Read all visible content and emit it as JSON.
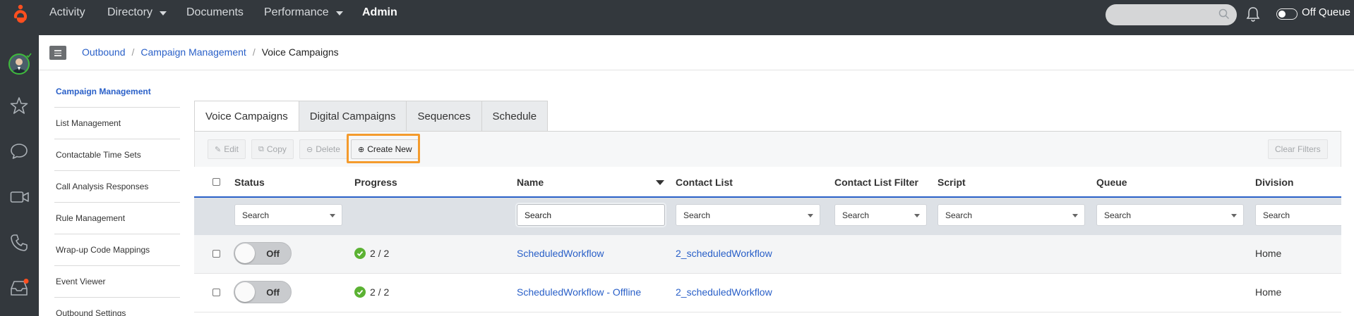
{
  "topnav": {
    "items": [
      {
        "label": "Activity",
        "has_caret": false
      },
      {
        "label": "Directory",
        "has_caret": true
      },
      {
        "label": "Documents",
        "has_caret": false
      },
      {
        "label": "Performance",
        "has_caret": true
      },
      {
        "label": "Admin",
        "has_caret": false,
        "active": true
      }
    ],
    "queue_status": "Off Queue",
    "brand_color": "#ff4f1f"
  },
  "breadcrumb": {
    "items": [
      "Outbound",
      "Campaign Management"
    ],
    "current": "Voice Campaigns"
  },
  "sidebar": {
    "items": [
      {
        "label": "Campaign Management",
        "active": true
      },
      {
        "label": "List Management"
      },
      {
        "label": "Contactable Time Sets"
      },
      {
        "label": "Call Analysis Responses"
      },
      {
        "label": "Rule Management"
      },
      {
        "label": "Wrap-up Code Mappings"
      },
      {
        "label": "Event Viewer"
      },
      {
        "label": "Outbound Settings"
      }
    ]
  },
  "tabs": [
    {
      "label": "Voice Campaigns",
      "active": true
    },
    {
      "label": "Digital Campaigns"
    },
    {
      "label": "Sequences"
    },
    {
      "label": "Schedule"
    }
  ],
  "toolbar": {
    "edit": "Edit",
    "copy": "Copy",
    "delete": "Delete",
    "create_new": "Create New",
    "clear_filters": "Clear Filters"
  },
  "table": {
    "columns": [
      "Status",
      "Progress",
      "Name",
      "Contact List",
      "Contact List Filter",
      "Script",
      "Queue",
      "Division"
    ],
    "filters": {
      "status": "Search",
      "name": "Search",
      "contact_list": "Search",
      "contact_list_filter": "Search",
      "script": "Search",
      "queue": "Search",
      "division": "Search"
    },
    "rows": [
      {
        "status": "Off",
        "progress": "2 / 2",
        "name": "ScheduledWorkflow",
        "contact_list": "2_scheduledWorkflow",
        "division": "Home"
      },
      {
        "status": "Off",
        "progress": "2 / 2",
        "name": "ScheduledWorkflow - Offline",
        "contact_list": "2_scheduledWorkflow",
        "division": "Home"
      }
    ]
  },
  "colors": {
    "link": "#2a60c8",
    "highlight": "#f49b2d",
    "success": "#5bb233",
    "topbar": "#33383d"
  }
}
